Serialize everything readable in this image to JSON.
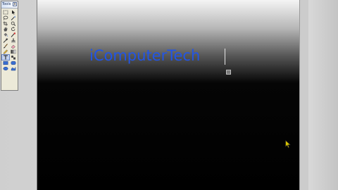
{
  "toolbox": {
    "title": "Tools",
    "close_glyph": "x",
    "tools": [
      {
        "name": "marquee-rect-icon"
      },
      {
        "name": "move-arrow-icon"
      },
      {
        "name": "lasso-icon"
      },
      {
        "name": "magic-wand-icon"
      },
      {
        "name": "crop-icon"
      },
      {
        "name": "zoom-icon"
      },
      {
        "name": "pan-hand-icon"
      },
      {
        "name": "rotate-icon"
      },
      {
        "name": "paint-bucket-icon"
      },
      {
        "name": "recolor-icon"
      },
      {
        "name": "eyedropper-icon"
      },
      {
        "name": "clone-stamp-icon"
      },
      {
        "name": "paintbrush-icon"
      },
      {
        "name": "eraser-icon"
      },
      {
        "name": "pencil-icon"
      },
      {
        "name": "gradient-icon"
      },
      {
        "name": "text-tool-icon"
      },
      {
        "name": "shapes-icon"
      },
      {
        "name": "rectangle-icon"
      },
      {
        "name": "rounded-rectangle-icon"
      },
      {
        "name": "ellipse-icon"
      },
      {
        "name": "freeform-icon"
      }
    ],
    "active_tool": "text-tool-icon"
  },
  "canvas": {
    "text": "iComputerTech",
    "text_color": "#2155e6",
    "background_gradient": [
      "#f4f4f4",
      "#000000"
    ]
  },
  "colors": {
    "workspace": "#d0d0d0",
    "toolbox_bg": "#ece9d8"
  }
}
